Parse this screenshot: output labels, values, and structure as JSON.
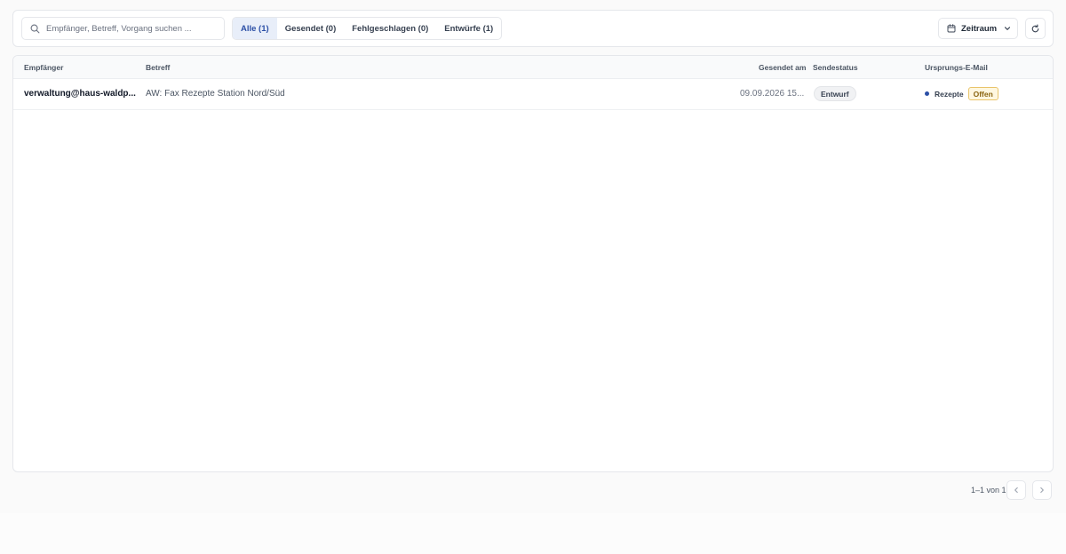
{
  "search": {
    "placeholder": "Empfänger, Betreff, Vorgang suchen ...",
    "value": "",
    "icon": "search-icon"
  },
  "filter_tabs": [
    {
      "label": "Alle (1)",
      "active": true
    },
    {
      "label": "Gesendet (0)",
      "active": false
    },
    {
      "label": "Fehlgeschlagen (0)",
      "active": false
    },
    {
      "label": "Entwürfe (1)",
      "active": false
    }
  ],
  "date_filter": {
    "label": "Zeitraum",
    "icon": "calendar-icon",
    "chevron": "chevron-down-icon"
  },
  "refresh": {
    "icon": "refresh-icon"
  },
  "table": {
    "columns": {
      "recipient": "Empfänger",
      "subject": "Betreff",
      "sent_at": "Gesendet am",
      "status": "Sendestatus",
      "origin": "Ursprungs-E-Mail"
    },
    "rows": [
      {
        "recipient": "verwaltung@haus-waldp...",
        "subject": "AW: Fax Rezepte Station Nord/Süd",
        "sent_at": "09.09.2026 15...",
        "status": "Entwurf",
        "origin_name": "Rezepte",
        "origin_badge": "Offen"
      }
    ]
  },
  "pagination": {
    "text": "1–1 von 1",
    "prev_icon": "chevron-left-icon",
    "next_icon": "chevron-right-icon"
  },
  "colors": {
    "accent": "#2b4fa6",
    "active_tab_bg": "#e8eef9",
    "offen_bg": "#fef7e0",
    "offen_border": "#e9c46a"
  }
}
